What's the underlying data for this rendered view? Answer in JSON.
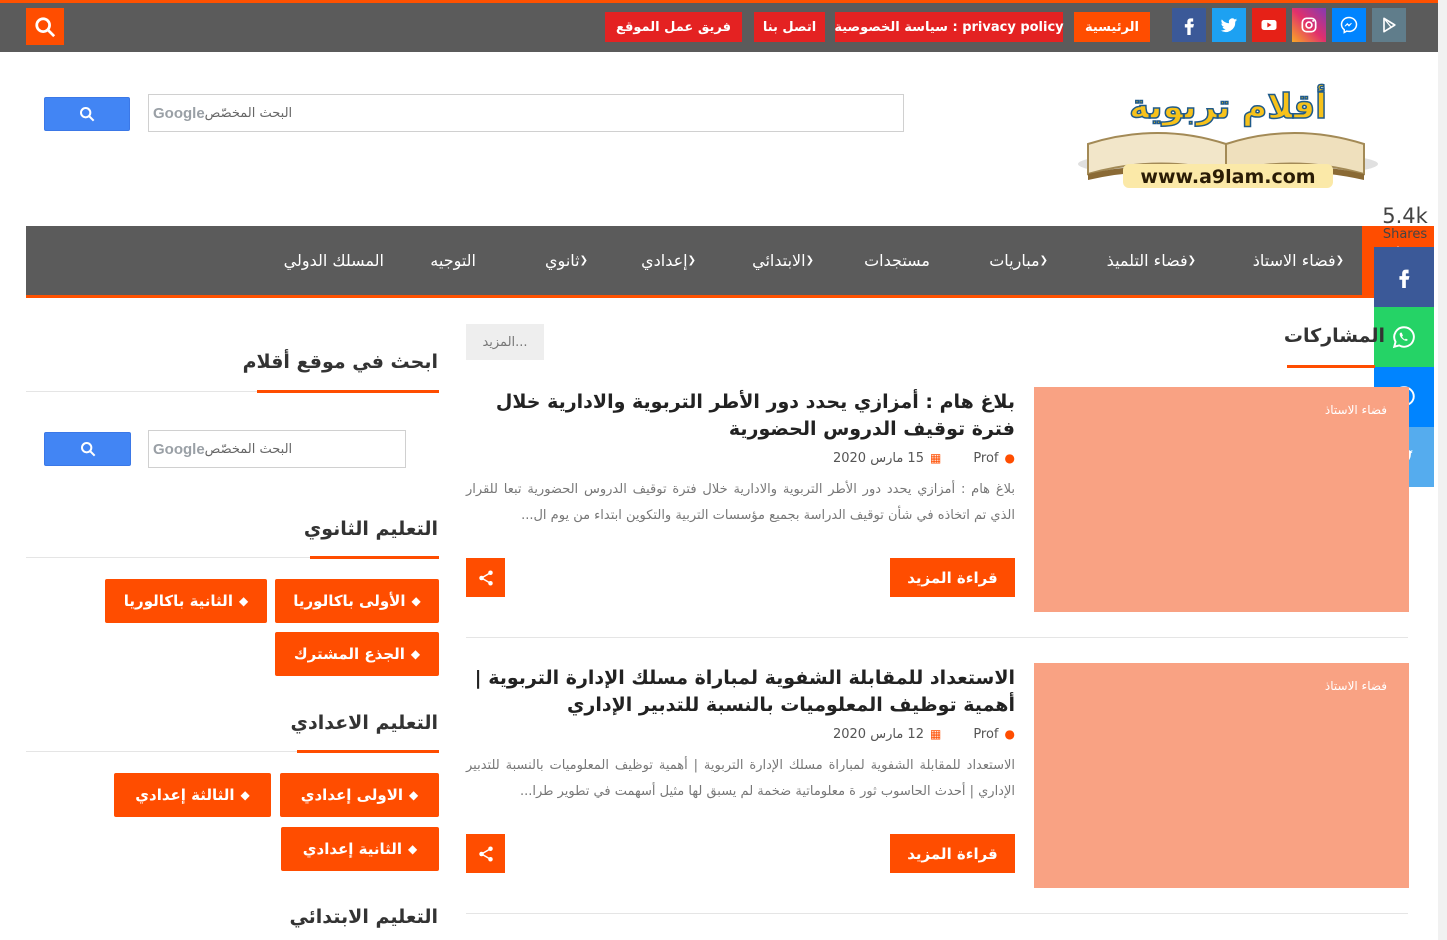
{
  "topbar": {
    "links": [
      {
        "label": "الرئيسية",
        "active": true
      },
      {
        "label": "سياسة الخصوصية : privacy policy"
      },
      {
        "label": "اتصل بنا"
      },
      {
        "label": "فريق عمل الموقع"
      }
    ],
    "social": [
      {
        "name": "facebook-icon",
        "color": "#3b5998"
      },
      {
        "name": "twitter-icon",
        "color": "#1da1f2"
      },
      {
        "name": "youtube-icon",
        "color": "#e62117"
      },
      {
        "name": "instagram-icon",
        "color": "#c13584"
      },
      {
        "name": "messenger-icon",
        "color": "#0084ff"
      },
      {
        "name": "google-play-icon",
        "color": "#607d8b"
      }
    ]
  },
  "header": {
    "search_brand": "Google",
    "search_placeholder": "البحث المخصّص",
    "logo_title": "أقلام تربوية",
    "logo_url": "www.a9lam.com"
  },
  "nav": {
    "items": [
      {
        "label": "فضاء الاستاذ",
        "dropdown": true
      },
      {
        "label": "فضاء التلميذ",
        "dropdown": true
      },
      {
        "label": "مباريات",
        "dropdown": true
      },
      {
        "label": "مستجدات",
        "dropdown": false
      },
      {
        "label": "الابتدائي",
        "dropdown": true
      },
      {
        "label": "إعدادي",
        "dropdown": true
      },
      {
        "label": "ثانوي",
        "dropdown": true
      },
      {
        "label": "التوجيه",
        "dropdown": false
      },
      {
        "label": "المسلك الدولي",
        "dropdown": false
      }
    ]
  },
  "shares": {
    "count": "5.4k",
    "label": "Shares"
  },
  "main": {
    "section_title": "المشاركات",
    "more_label": "المزيد...",
    "posts": [
      {
        "category": "فضاء الاستاذ",
        "title": "بلاغ هام : أمزازي يحدد دور الأطر التربوية والادارية خلال فترة توقيف الدروس الحضورية",
        "author": "Prof",
        "date": "15 مارس 2020",
        "excerpt": "بلاغ هام :  أمزازي يحدد دور الأطر التربوية والادارية خلال فترة توقيف الدروس الحضورية تبعا للقرار الذي تم اتخاذه في شأن توقيف الدراسة بجميع مؤسسات التربية والتكوين ابتداء من يوم ال...",
        "read_more": "قراءة المزيد"
      },
      {
        "category": "فضاء الاستاذ",
        "title": "الاستعداد للمقابلة الشفوية لمباراة مسلك الإدارة التربوية | أهمية توظيف المعلوميات بالنسبة للتدبير الإداري",
        "author": "Prof",
        "date": "12 مارس 2020",
        "excerpt": "الاستعداد للمقابلة الشفوية لمباراة مسلك الإدارة التربوية   |  أهمية توظيف المعلوميات بالنسبة للتدبير الإداري | أحدث الحاسوب ثور ة معلوماتية ضخمة لم يسبق لها مثيل أسهمت في تطوير طرا...",
        "read_more": "قراءة المزيد"
      }
    ]
  },
  "sidebar": {
    "search_title": "ابحث في موقع أقلام",
    "secondary_title": "التعليم الثانوي",
    "secondary_tags": [
      "الأولى باكالوريا",
      "الثانية باكالوريا",
      "الجذع المشترك"
    ],
    "middle_title": "التعليم الاعدادي",
    "middle_tags": [
      "الاولى إعدادي",
      "الثالثة إعدادي",
      "الثانية إعدادي"
    ],
    "primary_title": "التعليم الابتدائي"
  },
  "colors": {
    "accent": "#ff4d00",
    "bar": "#5b5b5b",
    "thumb": "#f9a283",
    "top_link": "#e42222"
  }
}
